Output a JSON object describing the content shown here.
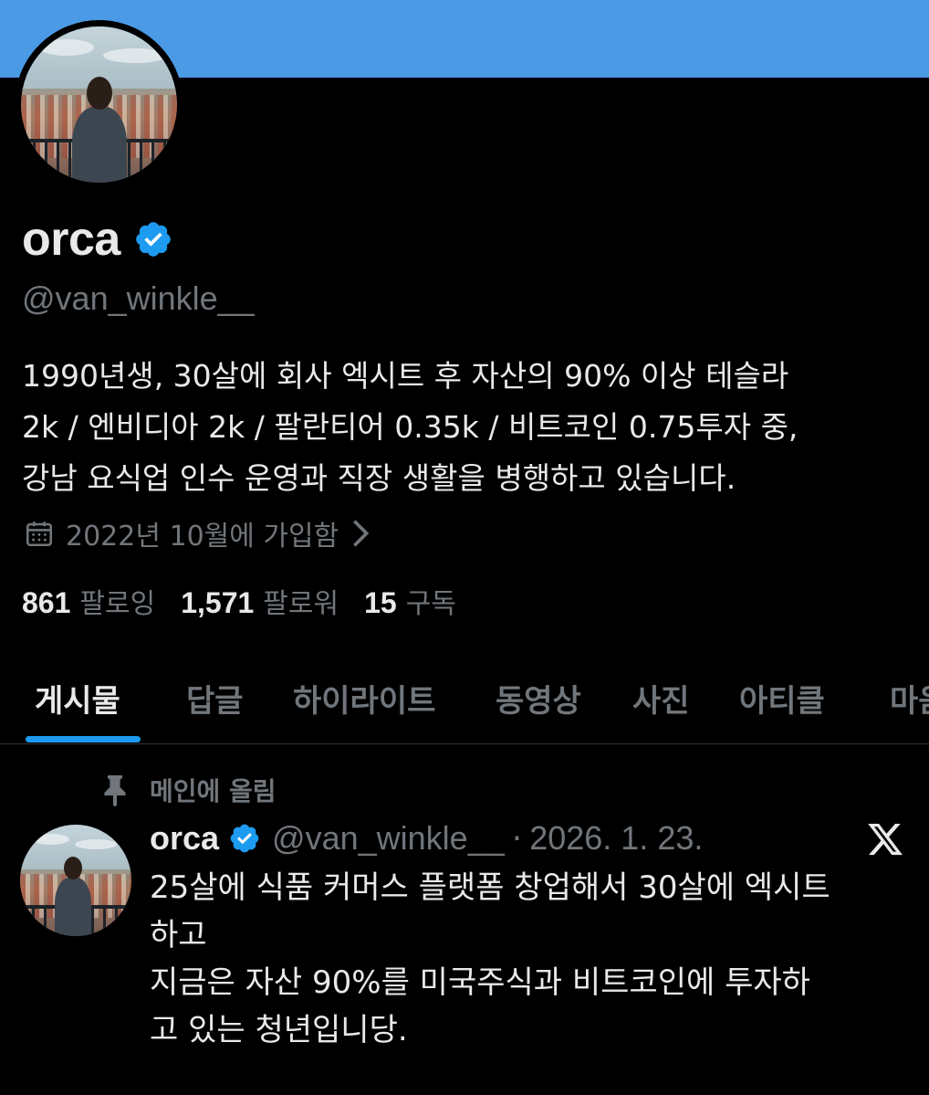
{
  "profile": {
    "display_name": "orca",
    "handle": "@van_winkle__",
    "bio_lines": [
      "1990년생, 30살에 회사 엑시트 후 자산의 90% 이상 테슬라",
      "2k / 엔비디아 2k / 팔란티어 0.35k / 비트코인 0.75투자 중,",
      "강남 요식업 인수 운영과 직장 생활을 병행하고 있습니다."
    ],
    "joined": "2022년 10월에 가입함",
    "stats": {
      "following_count": "861",
      "following_label": "팔로잉",
      "followers_count": "1,571",
      "followers_label": "팔로워",
      "subscriptions_count": "15",
      "subscriptions_label": "구독"
    }
  },
  "tabs": [
    "게시물",
    "답글",
    "하이라이트",
    "동영상",
    "사진",
    "아티클",
    "마음"
  ],
  "active_tab": "게시물",
  "pinned_tweet": {
    "pinned_label": "메인에 올림",
    "author_name": "orca",
    "author_handle": "@van_winkle__",
    "separator": "·",
    "date": "2026. 1. 23.",
    "text_lines": [
      "25살에 식품 커머스 플랫폼 창업해서 30살에 엑시트",
      "하고",
      "지금은 자산 90%를 미국주식과 비트코인에  투자하",
      "고 있는 청년입니당."
    ]
  },
  "icons": {
    "verified": "verified-badge-icon",
    "calendar": "calendar-icon",
    "chevron": "chevron-right-icon",
    "pin": "pin-icon",
    "x_logo": "x-logo-icon"
  },
  "colors": {
    "banner": "#4a9ae6",
    "background": "#000000",
    "accent": "#1d9bf0",
    "text_primary": "#e7e9ea",
    "text_secondary": "#71767b"
  }
}
